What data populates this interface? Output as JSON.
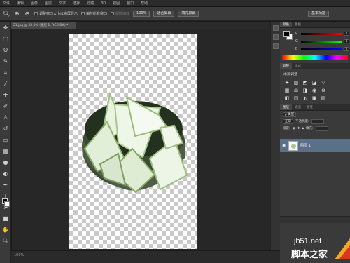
{
  "menubar": {
    "items": [
      "文件",
      "编辑",
      "图像",
      "图层",
      "文字",
      "选择",
      "滤镜",
      "3D",
      "视图",
      "窗口",
      "帮助"
    ]
  },
  "options": {
    "resize_windows": "调整窗口大小以满屏显示",
    "zoom_all": "缩放所有窗口",
    "scrubby_zoom": "细微缩放",
    "zoom_100": "100%",
    "fit_screen": "适合屏幕",
    "fill_screen": "填充屏幕",
    "workspace": "基本功能"
  },
  "document": {
    "tab": "21.jpg @ 33.3% (图层 1, RGB/8#) *"
  },
  "color_panel": {
    "tab_color": "颜色",
    "tab_swatches": "色板",
    "channels": [
      {
        "label": "R",
        "value": "0",
        "from": "#000000",
        "to": "#ff0000"
      },
      {
        "label": "G",
        "value": "0",
        "from": "#000000",
        "to": "#00ff00"
      },
      {
        "label": "B",
        "value": "0",
        "from": "#000000",
        "to": "#0000ff"
      }
    ]
  },
  "adjustments": {
    "tab_adjust": "调整",
    "tab_styles": "样式",
    "title": "添加调整"
  },
  "layers": {
    "tabs": [
      "图层",
      "通道",
      "路径"
    ],
    "kind": "ρ 类型",
    "blend": "正常",
    "opacity_label": "不透明度:",
    "lock_label": "锁定:",
    "fill_label": "填充:",
    "layer_name": "图层 1"
  },
  "watermark": {
    "site": "jb51.net",
    "name": "脚本之家"
  }
}
